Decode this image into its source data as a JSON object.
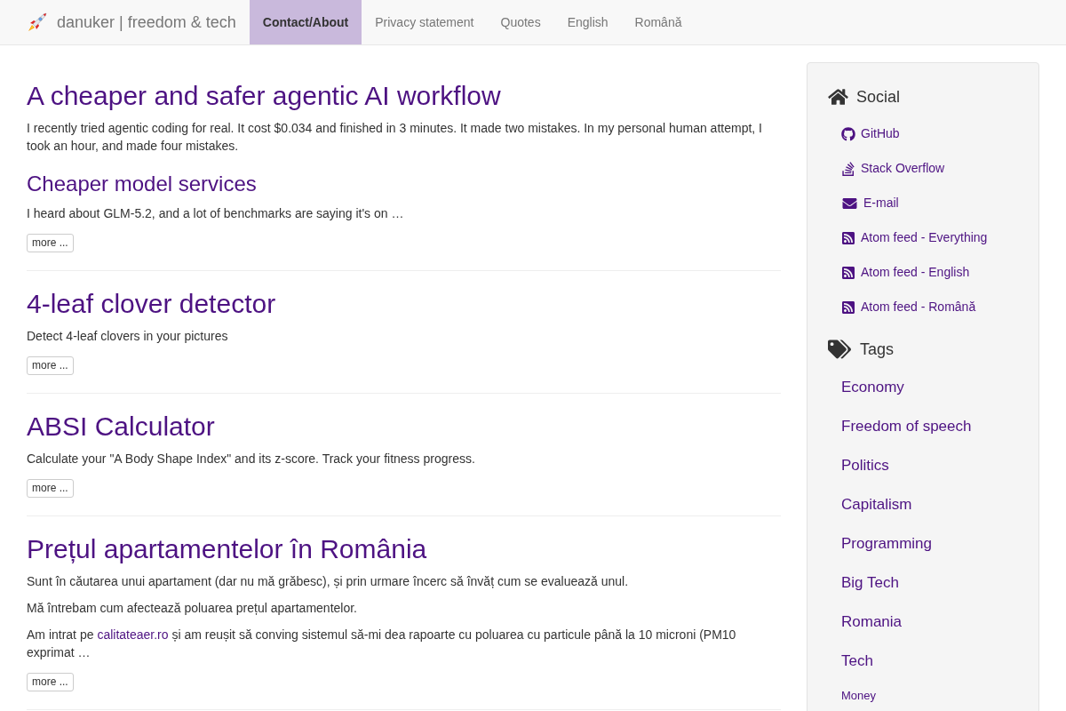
{
  "navbar": {
    "brand": "danuker | freedom & tech",
    "items": [
      {
        "label": "Contact/About",
        "selected": true
      },
      {
        "label": "Privacy statement",
        "selected": false
      },
      {
        "label": "Quotes",
        "selected": false
      },
      {
        "label": "English",
        "selected": false
      },
      {
        "label": "Română",
        "selected": false
      }
    ]
  },
  "posts": [
    {
      "title": "A cheaper and safer agentic AI workflow",
      "blocks": [
        {
          "kind": "paragraph",
          "parts": [
            {
              "kind": "text",
              "text": "I recently tried agentic coding for real. It cost $0.034 and finished in 3 minutes. It made two mistakes. In my personal human attempt, I took an hour, and made four mistakes."
            }
          ]
        },
        {
          "kind": "heading",
          "text": "Cheaper model services"
        },
        {
          "kind": "paragraph",
          "parts": [
            {
              "kind": "text",
              "text": "I heard about GLM-5.2, and a lot of benchmarks are saying it's on …"
            }
          ]
        }
      ],
      "more_button": "more ..."
    },
    {
      "title": "4-leaf clover detector",
      "blocks": [
        {
          "kind": "paragraph",
          "parts": [
            {
              "kind": "text",
              "text": "Detect 4-leaf clovers in your pictures"
            }
          ]
        }
      ],
      "more_button": "more ..."
    },
    {
      "title": "ABSI Calculator",
      "blocks": [
        {
          "kind": "paragraph",
          "parts": [
            {
              "kind": "text",
              "text": "Calculate your \"A Body Shape Index\" and its z-score. Track your fitness progress."
            }
          ]
        }
      ],
      "more_button": "more ..."
    },
    {
      "title": "Prețul apartamentelor în România",
      "blocks": [
        {
          "kind": "paragraph",
          "parts": [
            {
              "kind": "text",
              "text": "Sunt în căutarea unui apartament (dar nu mă grăbesc), și prin urmare încerc să învăț cum se evaluează unul."
            }
          ]
        },
        {
          "kind": "paragraph",
          "parts": [
            {
              "kind": "text",
              "text": "Mă întrebam cum afectează poluarea prețul apartamentelor."
            }
          ]
        },
        {
          "kind": "paragraph",
          "parts": [
            {
              "kind": "text",
              "text": "Am intrat pe "
            },
            {
              "kind": "link",
              "text": "calitateaer.ro"
            },
            {
              "kind": "text",
              "text": " și am reușit să conving sistemul să-mi dea rapoarte cu poluarea cu particule până la 10 microni (PM10 exprimat …"
            }
          ]
        }
      ],
      "more_button": "more ..."
    }
  ],
  "sidebar": {
    "social": {
      "title": "Social",
      "links": [
        {
          "label": "GitHub",
          "kind": "github"
        },
        {
          "label": "Stack Overflow",
          "kind": "stackoverflow"
        },
        {
          "label": "E-mail",
          "kind": "email"
        },
        {
          "label": "Atom feed - Everything",
          "kind": "feed"
        },
        {
          "label": "Atom feed - English",
          "kind": "feed"
        },
        {
          "label": "Atom feed - Română",
          "kind": "feed"
        }
      ]
    },
    "tags": {
      "title": "Tags",
      "items": [
        {
          "label": "Economy",
          "kind": "large"
        },
        {
          "label": "Freedom of speech",
          "kind": "large"
        },
        {
          "label": "Politics",
          "kind": "large"
        },
        {
          "label": "Capitalism",
          "kind": "large"
        },
        {
          "label": "Programming",
          "kind": "large"
        },
        {
          "label": "Big Tech",
          "kind": "large"
        },
        {
          "label": "Romania",
          "kind": "large"
        },
        {
          "label": "Tech",
          "kind": "large"
        },
        {
          "label": "Money",
          "kind": "small"
        }
      ]
    }
  }
}
